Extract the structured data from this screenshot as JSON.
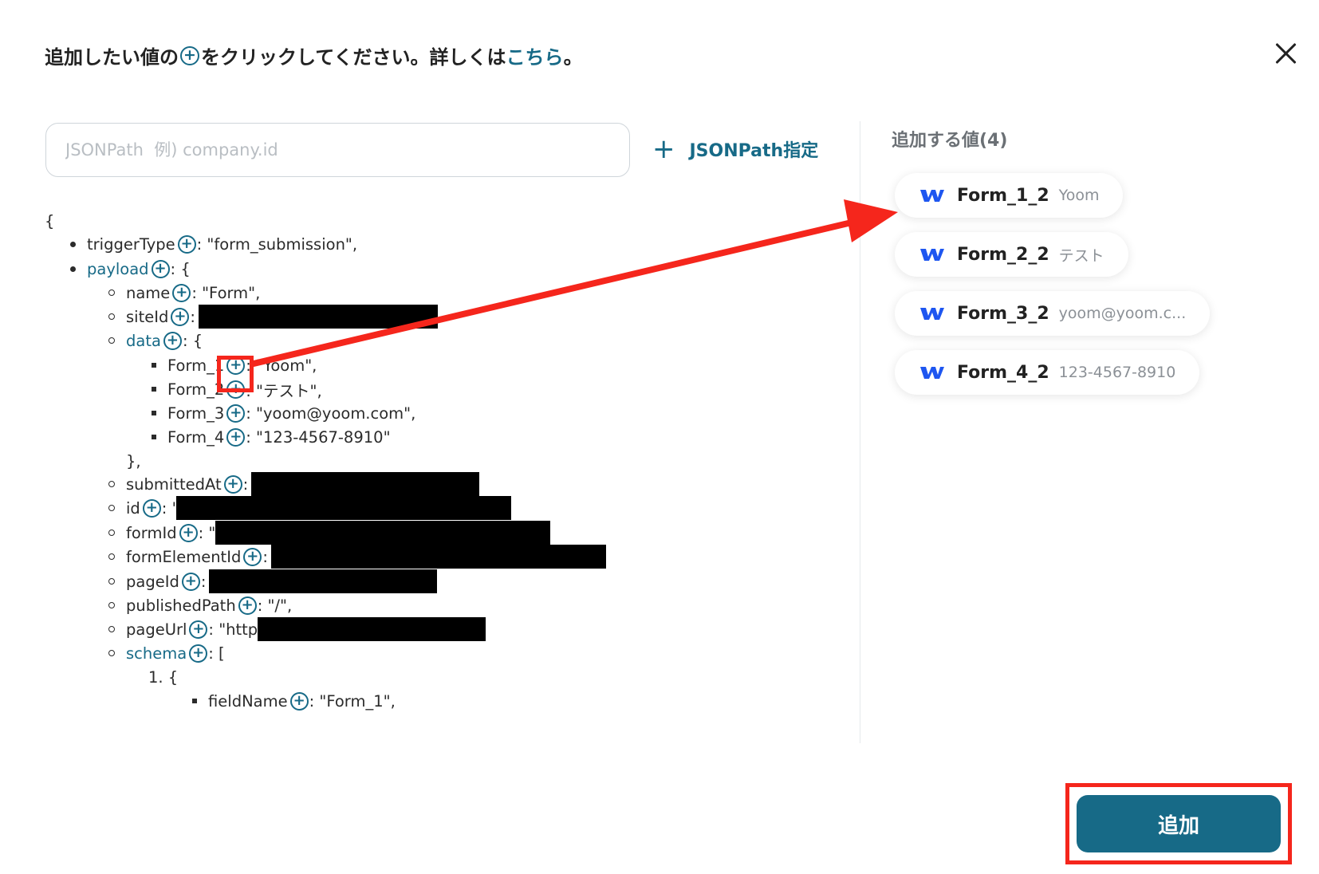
{
  "header": {
    "text_before": "追加したい値の",
    "text_after": "をクリックしてください。詳しくは",
    "link": "こちら",
    "period": "。"
  },
  "search": {
    "placeholder": "JSONPath  例) company.id"
  },
  "jsonpath_button": {
    "label": "JSONPath指定"
  },
  "tree": {
    "open_brace": "{",
    "triggerType": {
      "key": "triggerType",
      "value": ": \"form_submission\","
    },
    "payload": {
      "key": "payload",
      "value": ": {"
    },
    "name": {
      "key": "name",
      "value": ": \"Form\","
    },
    "siteId": {
      "key": "siteId",
      "value": ":"
    },
    "data": {
      "key": "data",
      "value": ": {"
    },
    "form1": {
      "key": "Form_1",
      "value": ": \"Yoom\","
    },
    "form2": {
      "key": "Form_2",
      "value": ": \"テスト\","
    },
    "form3": {
      "key": "Form_3",
      "value": ": \"yoom@yoom.com\","
    },
    "form4": {
      "key": "Form_4",
      "value": ": \"123-4567-8910\""
    },
    "close_data": "},",
    "submittedAt": {
      "key": "submittedAt",
      "value": ":"
    },
    "id": {
      "key": "id",
      "value": ": '"
    },
    "formId": {
      "key": "formId",
      "value": ": \""
    },
    "formElementId": {
      "key": "formElementId",
      "value": ":"
    },
    "pageId": {
      "key": "pageId",
      "value": ":"
    },
    "publishedPath": {
      "key": "publishedPath",
      "value": ": \"/\","
    },
    "pageUrl": {
      "key": "pageUrl",
      "value": ": \"http"
    },
    "schema": {
      "key": "schema",
      "value": ": ["
    },
    "list_item_1": "1. {",
    "fieldName": {
      "key": "fieldName",
      "value": ": \"Form_1\","
    }
  },
  "side": {
    "title": "追加する値(4)",
    "chips": [
      {
        "name": "Form_1_2",
        "value": "Yoom"
      },
      {
        "name": "Form_2_2",
        "value": "テスト"
      },
      {
        "name": "Form_3_2",
        "value": "yoom@yoom.c..."
      },
      {
        "name": "Form_4_2",
        "value": "123-4567-8910"
      }
    ]
  },
  "add_button": {
    "label": "追加"
  },
  "colors": {
    "accent": "#176a87",
    "annotation": "#f5261c",
    "redaction": "#000000"
  },
  "icons": {
    "plus": "plus-circle-icon",
    "close": "close-icon",
    "webflow": "webflow-logo-icon"
  }
}
